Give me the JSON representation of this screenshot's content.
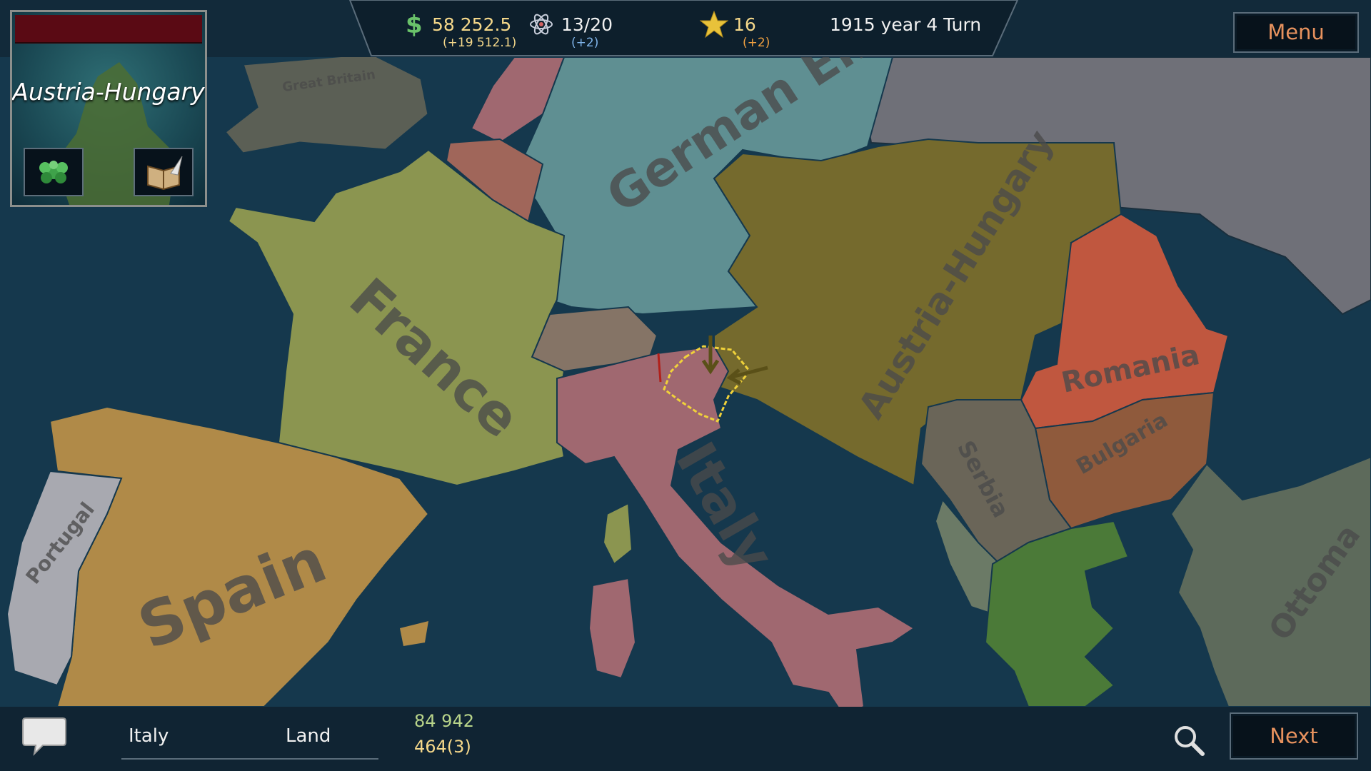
{
  "top": {
    "money": "58 252.5",
    "money_income": "(+19 512.1)",
    "science": "13/20",
    "science_delta": "(+2)",
    "stars": "16",
    "stars_delta": "(+2)",
    "date_turn": "1915 year 4 Turn"
  },
  "menu_label": "Menu",
  "flag_panel": {
    "country": "Austria-Hungary"
  },
  "map_labels": {
    "great_britain": "Great Britain",
    "german_empire": "German Emp",
    "france": "France",
    "austria_hungary": "Austria-Hungary",
    "spain": "Spain",
    "portugal": "Portugal",
    "italy": "Italy",
    "romania": "Romania",
    "bulgaria": "Bulgaria",
    "serbia": "Serbia",
    "ottoman": "Ottoma"
  },
  "bottom": {
    "selected_country": "Italy",
    "province_type": "Land",
    "population": "84 942",
    "army": "464(3)"
  },
  "next_label": "Next",
  "colors": {
    "sea": "#15384d",
    "france": "#8b9550",
    "germany": "#5f8f92",
    "austria": "#756a2d",
    "italy": "#a06870",
    "spain": "#b08a48",
    "portugal": "#a8a9b0",
    "romania": "#c0573f",
    "bulgaria": "#8f5a3c",
    "serbia": "#6a6558",
    "greece": "#4b7a38",
    "russia": "#6f7078",
    "ottoman": "#5d6a5b",
    "britain": "#5b5f55",
    "ui_dark": "#102433",
    "accent_orange": "#e7925e",
    "selection_yellow": "#f0d23a"
  },
  "icons": [
    "dollar-icon",
    "atom-icon",
    "star-icon",
    "leaves-icon",
    "book-quill-icon",
    "chat-icon",
    "magnifier-icon"
  ]
}
